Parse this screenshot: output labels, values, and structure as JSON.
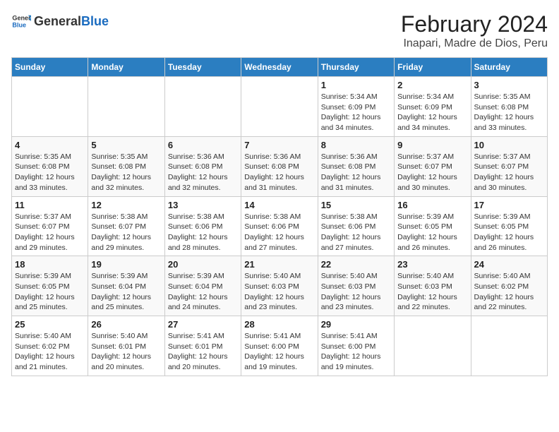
{
  "header": {
    "logo_general": "General",
    "logo_blue": "Blue",
    "title": "February 2024",
    "subtitle": "Inapari, Madre de Dios, Peru"
  },
  "days_of_week": [
    "Sunday",
    "Monday",
    "Tuesday",
    "Wednesday",
    "Thursday",
    "Friday",
    "Saturday"
  ],
  "weeks": [
    [
      {
        "day": "",
        "info": ""
      },
      {
        "day": "",
        "info": ""
      },
      {
        "day": "",
        "info": ""
      },
      {
        "day": "",
        "info": ""
      },
      {
        "day": "1",
        "info": "Sunrise: 5:34 AM\nSunset: 6:09 PM\nDaylight: 12 hours and 34 minutes."
      },
      {
        "day": "2",
        "info": "Sunrise: 5:34 AM\nSunset: 6:09 PM\nDaylight: 12 hours and 34 minutes."
      },
      {
        "day": "3",
        "info": "Sunrise: 5:35 AM\nSunset: 6:08 PM\nDaylight: 12 hours and 33 minutes."
      }
    ],
    [
      {
        "day": "4",
        "info": "Sunrise: 5:35 AM\nSunset: 6:08 PM\nDaylight: 12 hours and 33 minutes."
      },
      {
        "day": "5",
        "info": "Sunrise: 5:35 AM\nSunset: 6:08 PM\nDaylight: 12 hours and 32 minutes."
      },
      {
        "day": "6",
        "info": "Sunrise: 5:36 AM\nSunset: 6:08 PM\nDaylight: 12 hours and 32 minutes."
      },
      {
        "day": "7",
        "info": "Sunrise: 5:36 AM\nSunset: 6:08 PM\nDaylight: 12 hours and 31 minutes."
      },
      {
        "day": "8",
        "info": "Sunrise: 5:36 AM\nSunset: 6:08 PM\nDaylight: 12 hours and 31 minutes."
      },
      {
        "day": "9",
        "info": "Sunrise: 5:37 AM\nSunset: 6:07 PM\nDaylight: 12 hours and 30 minutes."
      },
      {
        "day": "10",
        "info": "Sunrise: 5:37 AM\nSunset: 6:07 PM\nDaylight: 12 hours and 30 minutes."
      }
    ],
    [
      {
        "day": "11",
        "info": "Sunrise: 5:37 AM\nSunset: 6:07 PM\nDaylight: 12 hours and 29 minutes."
      },
      {
        "day": "12",
        "info": "Sunrise: 5:38 AM\nSunset: 6:07 PM\nDaylight: 12 hours and 29 minutes."
      },
      {
        "day": "13",
        "info": "Sunrise: 5:38 AM\nSunset: 6:06 PM\nDaylight: 12 hours and 28 minutes."
      },
      {
        "day": "14",
        "info": "Sunrise: 5:38 AM\nSunset: 6:06 PM\nDaylight: 12 hours and 27 minutes."
      },
      {
        "day": "15",
        "info": "Sunrise: 5:38 AM\nSunset: 6:06 PM\nDaylight: 12 hours and 27 minutes."
      },
      {
        "day": "16",
        "info": "Sunrise: 5:39 AM\nSunset: 6:05 PM\nDaylight: 12 hours and 26 minutes."
      },
      {
        "day": "17",
        "info": "Sunrise: 5:39 AM\nSunset: 6:05 PM\nDaylight: 12 hours and 26 minutes."
      }
    ],
    [
      {
        "day": "18",
        "info": "Sunrise: 5:39 AM\nSunset: 6:05 PM\nDaylight: 12 hours and 25 minutes."
      },
      {
        "day": "19",
        "info": "Sunrise: 5:39 AM\nSunset: 6:04 PM\nDaylight: 12 hours and 25 minutes."
      },
      {
        "day": "20",
        "info": "Sunrise: 5:39 AM\nSunset: 6:04 PM\nDaylight: 12 hours and 24 minutes."
      },
      {
        "day": "21",
        "info": "Sunrise: 5:40 AM\nSunset: 6:03 PM\nDaylight: 12 hours and 23 minutes."
      },
      {
        "day": "22",
        "info": "Sunrise: 5:40 AM\nSunset: 6:03 PM\nDaylight: 12 hours and 23 minutes."
      },
      {
        "day": "23",
        "info": "Sunrise: 5:40 AM\nSunset: 6:03 PM\nDaylight: 12 hours and 22 minutes."
      },
      {
        "day": "24",
        "info": "Sunrise: 5:40 AM\nSunset: 6:02 PM\nDaylight: 12 hours and 22 minutes."
      }
    ],
    [
      {
        "day": "25",
        "info": "Sunrise: 5:40 AM\nSunset: 6:02 PM\nDaylight: 12 hours and 21 minutes."
      },
      {
        "day": "26",
        "info": "Sunrise: 5:40 AM\nSunset: 6:01 PM\nDaylight: 12 hours and 20 minutes."
      },
      {
        "day": "27",
        "info": "Sunrise: 5:41 AM\nSunset: 6:01 PM\nDaylight: 12 hours and 20 minutes."
      },
      {
        "day": "28",
        "info": "Sunrise: 5:41 AM\nSunset: 6:00 PM\nDaylight: 12 hours and 19 minutes."
      },
      {
        "day": "29",
        "info": "Sunrise: 5:41 AM\nSunset: 6:00 PM\nDaylight: 12 hours and 19 minutes."
      },
      {
        "day": "",
        "info": ""
      },
      {
        "day": "",
        "info": ""
      }
    ]
  ]
}
